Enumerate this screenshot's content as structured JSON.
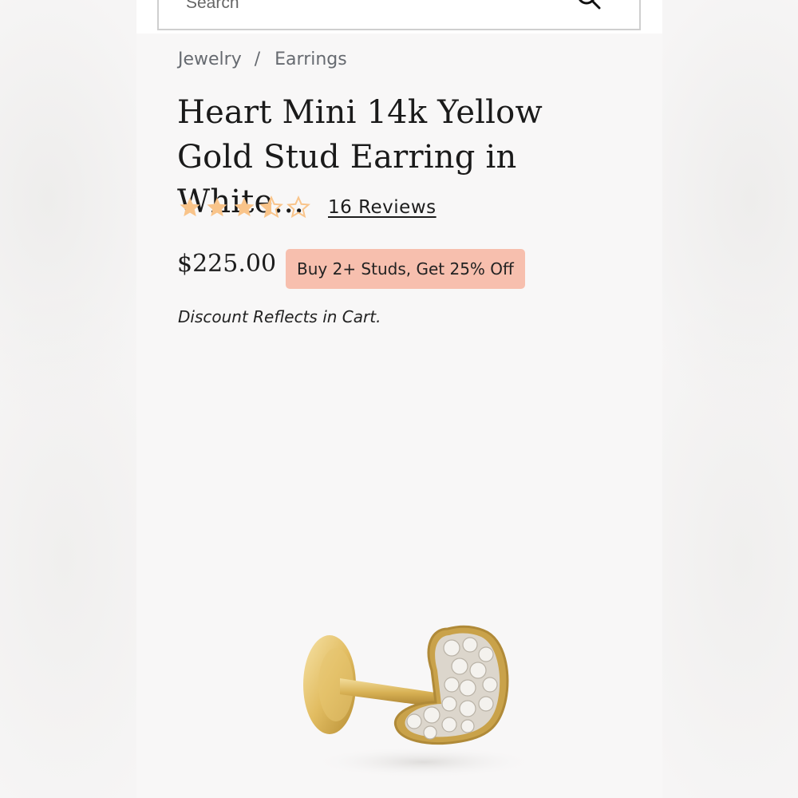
{
  "search": {
    "placeholder": "Search"
  },
  "breadcrumb": {
    "items": [
      "Jewelry",
      "Earrings"
    ],
    "separator": "/"
  },
  "product": {
    "title": "Heart Mini 14k Yellow Gold Stud Earring in White...",
    "rating": {
      "value": 3.5,
      "max": 5,
      "reviews_label": "16 Reviews"
    },
    "price": "$225.00",
    "promo": "Buy 2+ Studs, Get 25% Off",
    "discount_note": "Discount Reflects in Cart.",
    "image_alt": "heart stud earring"
  },
  "colors": {
    "star": "#f9c48a",
    "promo_bg": "#f7bfae",
    "gold": "#d9b45a"
  }
}
